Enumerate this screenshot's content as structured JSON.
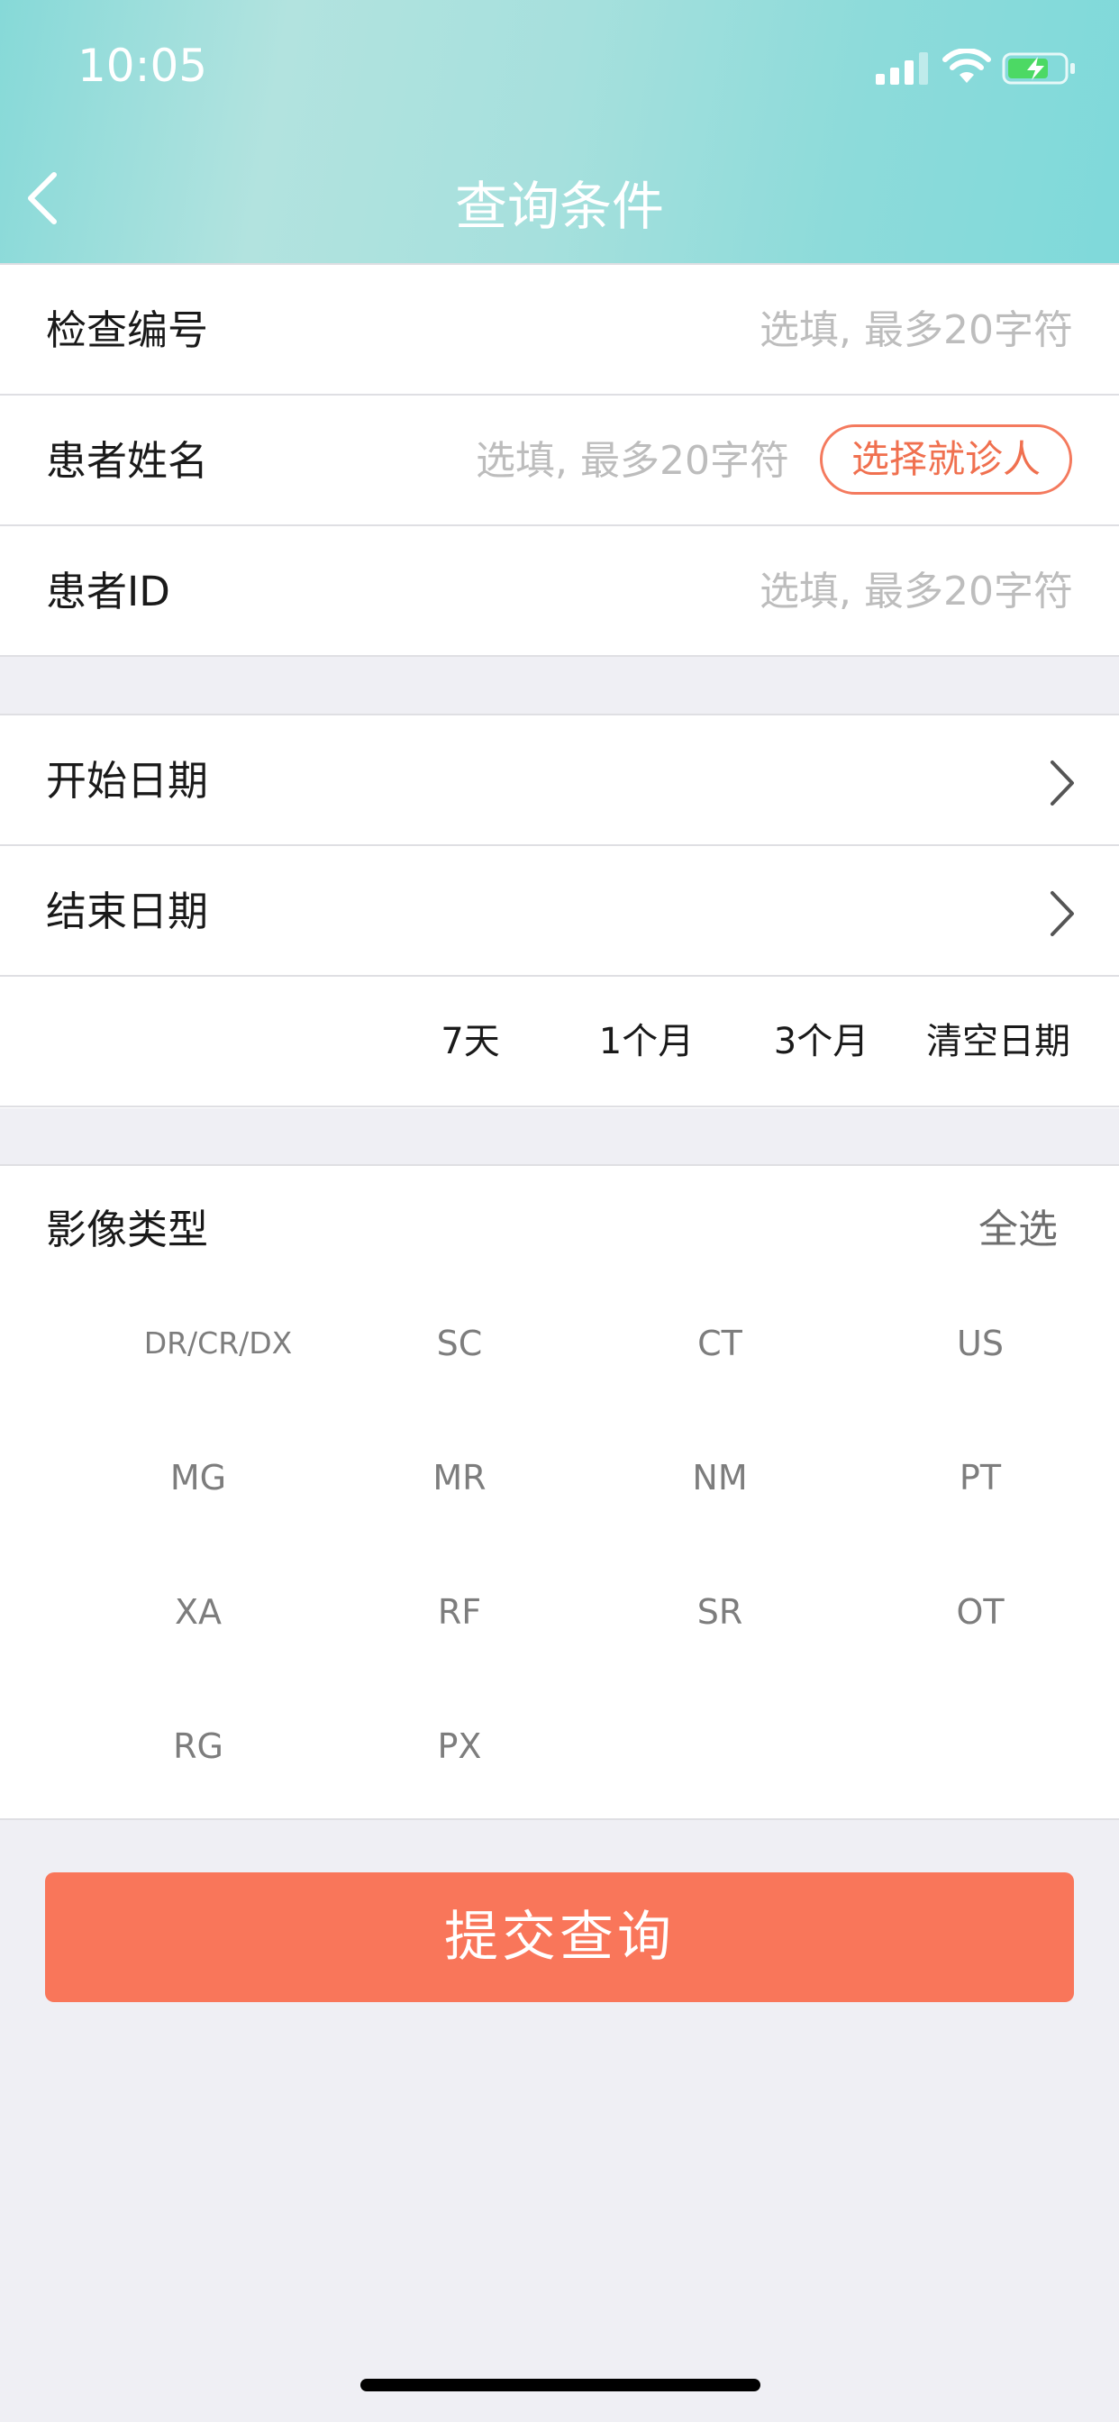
{
  "status_bar": {
    "time": "10:05"
  },
  "nav": {
    "title": "查询条件"
  },
  "fields": {
    "exam_number": {
      "label": "检查编号",
      "placeholder": "选填, 最多20字符"
    },
    "patient_name": {
      "label": "患者姓名",
      "placeholder": "选填, 最多20字符",
      "pick_button": "选择就诊人"
    },
    "patient_id": {
      "label": "患者ID",
      "placeholder": "选填, 最多20字符"
    }
  },
  "dates": {
    "start_label": "开始日期",
    "end_label": "结束日期",
    "quick": [
      "7天",
      "1个月",
      "3个月",
      "清空日期"
    ]
  },
  "modality": {
    "title": "影像类型",
    "select_all": "全选",
    "types": [
      "DR/CR/DX",
      "SC",
      "CT",
      "US",
      "MG",
      "MR",
      "NM",
      "PT",
      "XA",
      "RF",
      "SR",
      "OT",
      "RG",
      "PX"
    ]
  },
  "submit_label": "提交查询",
  "colors": {
    "accent": "#f9765a",
    "header": "#8ddbda",
    "background": "#efeff4"
  }
}
